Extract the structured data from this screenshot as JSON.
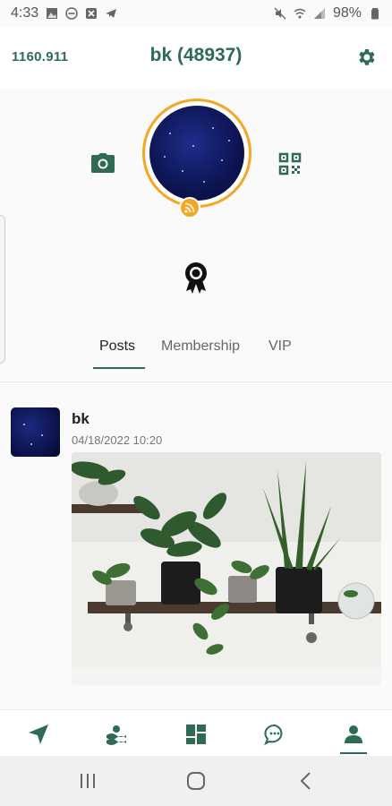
{
  "status_bar": {
    "time": "4:33",
    "battery": "98%",
    "left_icons": [
      "image-icon",
      "dnd-icon",
      "x-app-icon",
      "telegram-icon"
    ],
    "right_icons": [
      "mute-icon",
      "wifi-icon",
      "signal-icon",
      "battery-icon"
    ]
  },
  "header": {
    "balance": "1160.911",
    "username": "bk (48937)",
    "settings_icon": "gear-icon"
  },
  "profile": {
    "camera_icon": "camera-icon",
    "qr_icon": "qr-code-icon",
    "feed_icon": "rss-icon",
    "award_icon": "award-icon",
    "accent_color": "#2e6b52",
    "ring_color": "#f5a623"
  },
  "tabs": [
    {
      "label": "Posts",
      "active": true
    },
    {
      "label": "Membership",
      "active": false
    },
    {
      "label": "VIP",
      "active": false
    }
  ],
  "post": {
    "author": "bk",
    "date": "04/18/2022 10:20"
  },
  "bottom_nav": {
    "items": [
      "navigate-icon",
      "map-icon",
      "dashboard-icon",
      "chat-icon",
      "profile-icon"
    ],
    "active_index": 4
  },
  "system_nav": {
    "items": [
      "recents-icon",
      "home-icon",
      "back-icon"
    ]
  }
}
